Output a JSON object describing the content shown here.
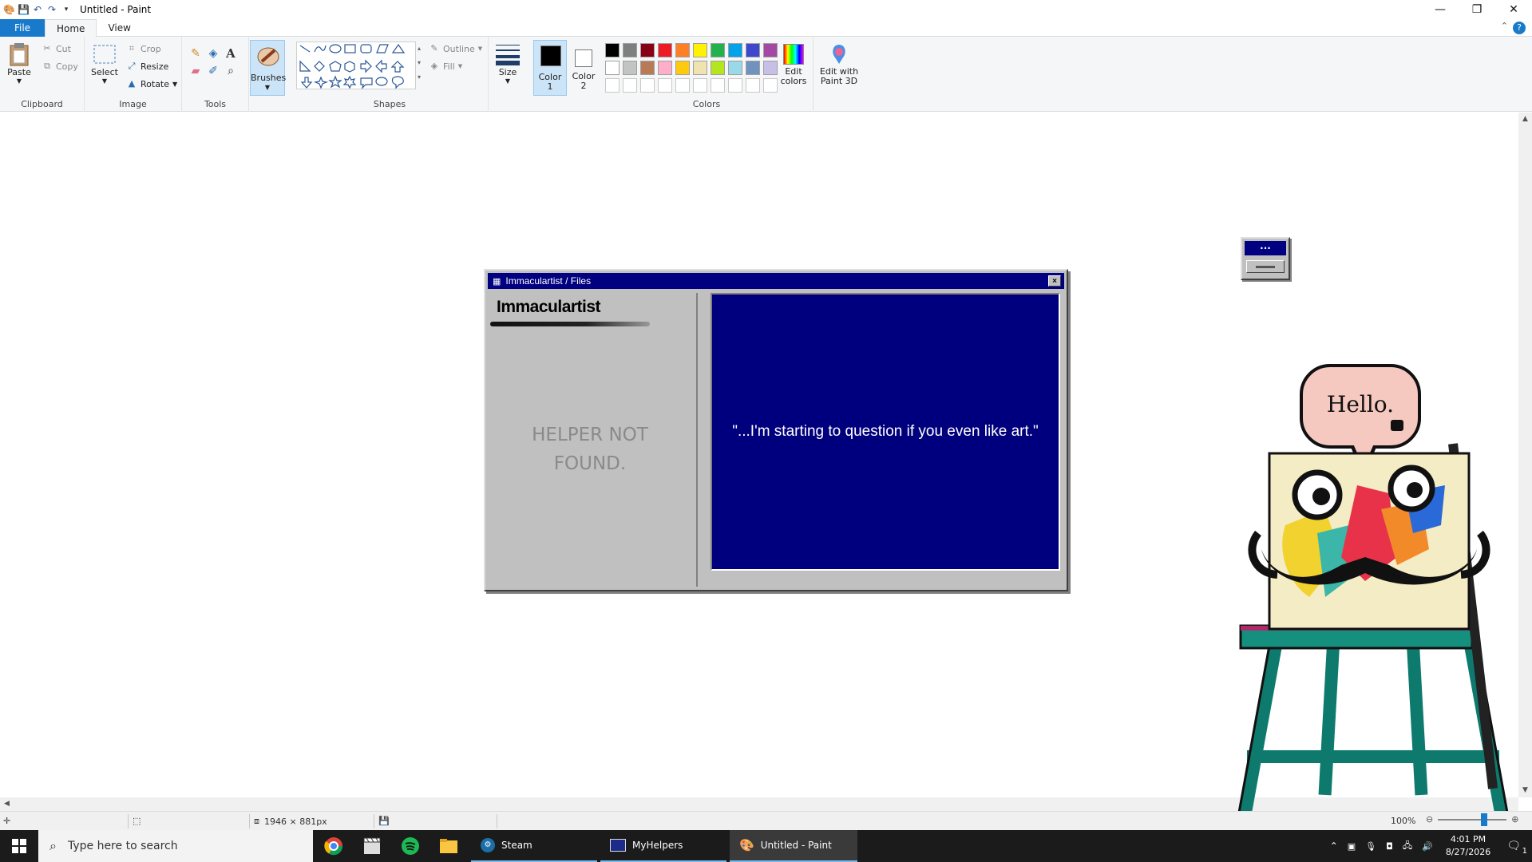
{
  "window": {
    "title": "Untitled - Paint",
    "minimize": "—",
    "restore": "❐",
    "close": "✕"
  },
  "tabs": [
    "File",
    "Home",
    "View"
  ],
  "ribbon": {
    "clipboard": {
      "paste": "Paste",
      "cut": "Cut",
      "copy": "Copy",
      "label": "Clipboard"
    },
    "image": {
      "select": "Select",
      "crop": "Crop",
      "resize": "Resize",
      "rotate": "Rotate",
      "label": "Image"
    },
    "tools": {
      "label": "Tools"
    },
    "brushes": {
      "label": "Brushes"
    },
    "shapes": {
      "outline": "Outline",
      "fill": "Fill",
      "label": "Shapes"
    },
    "size": {
      "label": "Size"
    },
    "color1": {
      "label_line1": "Color",
      "label_line2": "1",
      "value": "#000000"
    },
    "color2": {
      "label_line1": "Color",
      "label_line2": "2",
      "value": "#ffffff"
    },
    "colors": {
      "label": "Colors",
      "row1": [
        "#000000",
        "#7f7f7f",
        "#880015",
        "#ed1c24",
        "#ff7f27",
        "#fff200",
        "#22b14c",
        "#00a2e8",
        "#3f48cc",
        "#a349a4"
      ],
      "row2": [
        "#ffffff",
        "#c3c3c3",
        "#b97a57",
        "#ffaec9",
        "#ffc90e",
        "#efe4b0",
        "#b5e61d",
        "#99d9ea",
        "#7092be",
        "#c8bfe7"
      ]
    },
    "edit_colors": {
      "line1": "Edit",
      "line2": "colors"
    },
    "paint3d": {
      "line1": "Edit with",
      "line2": "Paint 3D"
    }
  },
  "canvas": {
    "retro_window": {
      "title": "Immaculartist / Files",
      "close": "×",
      "brand": "Immaculartist",
      "helper_line1": "HELPER NOT",
      "helper_line2": "FOUND.",
      "quote": "\"...I'm starting to question if you even like art.\""
    },
    "mini_window": {
      "title": "..."
    },
    "speech": "Hello."
  },
  "statusbar": {
    "dimensions": "1946 × 881px",
    "zoom": "100%"
  },
  "taskbar": {
    "search_placeholder": "Type here to search",
    "apps": [
      {
        "label": "Steam"
      },
      {
        "label": "MyHelpers"
      },
      {
        "label": "Untitled - Paint"
      }
    ],
    "time": "4:01 PM",
    "date": "8/27/2026",
    "notifications": "1"
  }
}
